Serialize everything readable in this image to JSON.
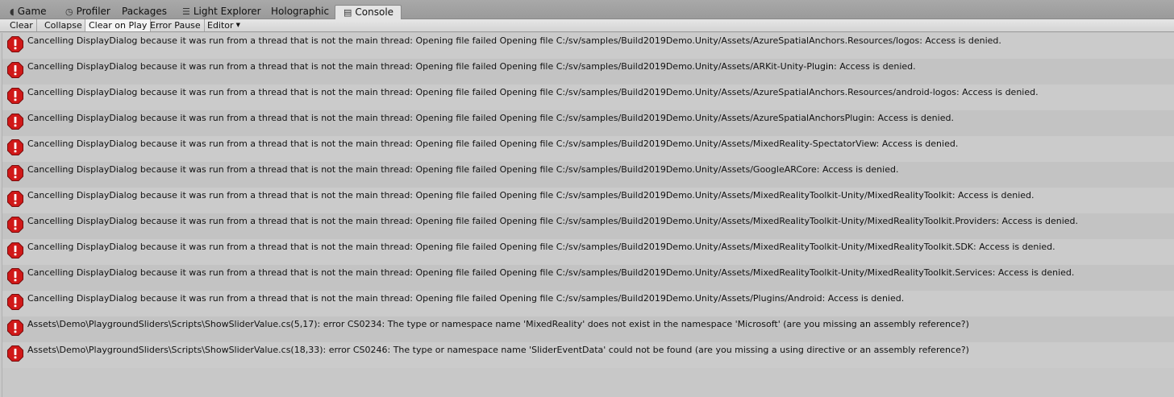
{
  "tabs": [
    {
      "label": "Game",
      "icon": "game-icon"
    },
    {
      "label": "Profiler",
      "icon": "profiler-icon"
    },
    {
      "label": "Packages",
      "icon": ""
    },
    {
      "label": "Light Explorer",
      "icon": "light-explorer-icon"
    },
    {
      "label": "Holographic",
      "icon": ""
    },
    {
      "label": "Console",
      "icon": "console-icon",
      "active": true
    }
  ],
  "toolbar": {
    "clear": "Clear",
    "collapse": "Collapse",
    "clear_on_play": "Clear on Play",
    "error_pause": "Error Pause",
    "editor": "Editor"
  },
  "colors": {
    "error_red": "#d01818",
    "row_even": "#cbcbcb",
    "row_odd": "#c3c3c3"
  },
  "logs": [
    {
      "type": "error",
      "text": "Cancelling DisplayDialog because it was run from a thread that is not the main thread: Opening file failed Opening file C:/sv/samples/Build2019Demo.Unity/Assets/AzureSpatialAnchors.Resources/logos: Access is denied."
    },
    {
      "type": "error",
      "text": "Cancelling DisplayDialog because it was run from a thread that is not the main thread: Opening file failed Opening file C:/sv/samples/Build2019Demo.Unity/Assets/ARKit-Unity-Plugin: Access is denied."
    },
    {
      "type": "error",
      "text": "Cancelling DisplayDialog because it was run from a thread that is not the main thread: Opening file failed Opening file C:/sv/samples/Build2019Demo.Unity/Assets/AzureSpatialAnchors.Resources/android-logos: Access is denied."
    },
    {
      "type": "error",
      "text": "Cancelling DisplayDialog because it was run from a thread that is not the main thread: Opening file failed Opening file C:/sv/samples/Build2019Demo.Unity/Assets/AzureSpatialAnchorsPlugin: Access is denied."
    },
    {
      "type": "error",
      "text": "Cancelling DisplayDialog because it was run from a thread that is not the main thread: Opening file failed Opening file C:/sv/samples/Build2019Demo.Unity/Assets/MixedReality-SpectatorView: Access is denied."
    },
    {
      "type": "error",
      "text": "Cancelling DisplayDialog because it was run from a thread that is not the main thread: Opening file failed Opening file C:/sv/samples/Build2019Demo.Unity/Assets/GoogleARCore: Access is denied."
    },
    {
      "type": "error",
      "text": "Cancelling DisplayDialog because it was run from a thread that is not the main thread: Opening file failed Opening file C:/sv/samples/Build2019Demo.Unity/Assets/MixedRealityToolkit-Unity/MixedRealityToolkit: Access is denied."
    },
    {
      "type": "error",
      "text": "Cancelling DisplayDialog because it was run from a thread that is not the main thread: Opening file failed Opening file C:/sv/samples/Build2019Demo.Unity/Assets/MixedRealityToolkit-Unity/MixedRealityToolkit.Providers: Access is denied."
    },
    {
      "type": "error",
      "text": "Cancelling DisplayDialog because it was run from a thread that is not the main thread: Opening file failed Opening file C:/sv/samples/Build2019Demo.Unity/Assets/MixedRealityToolkit-Unity/MixedRealityToolkit.SDK: Access is denied."
    },
    {
      "type": "error",
      "text": "Cancelling DisplayDialog because it was run from a thread that is not the main thread: Opening file failed Opening file C:/sv/samples/Build2019Demo.Unity/Assets/MixedRealityToolkit-Unity/MixedRealityToolkit.Services: Access is denied."
    },
    {
      "type": "error",
      "text": "Cancelling DisplayDialog because it was run from a thread that is not the main thread: Opening file failed Opening file C:/sv/samples/Build2019Demo.Unity/Assets/Plugins/Android: Access is denied."
    },
    {
      "type": "error",
      "text": "Assets\\Demo\\PlaygroundSliders\\Scripts\\ShowSliderValue.cs(5,17): error CS0234: The type or namespace name 'MixedReality' does not exist in the namespace 'Microsoft' (are you missing an assembly reference?)"
    },
    {
      "type": "error",
      "text": "Assets\\Demo\\PlaygroundSliders\\Scripts\\ShowSliderValue.cs(18,33): error CS0246: The type or namespace name 'SliderEventData' could not be found (are you missing a using directive or an assembly reference?)"
    }
  ]
}
